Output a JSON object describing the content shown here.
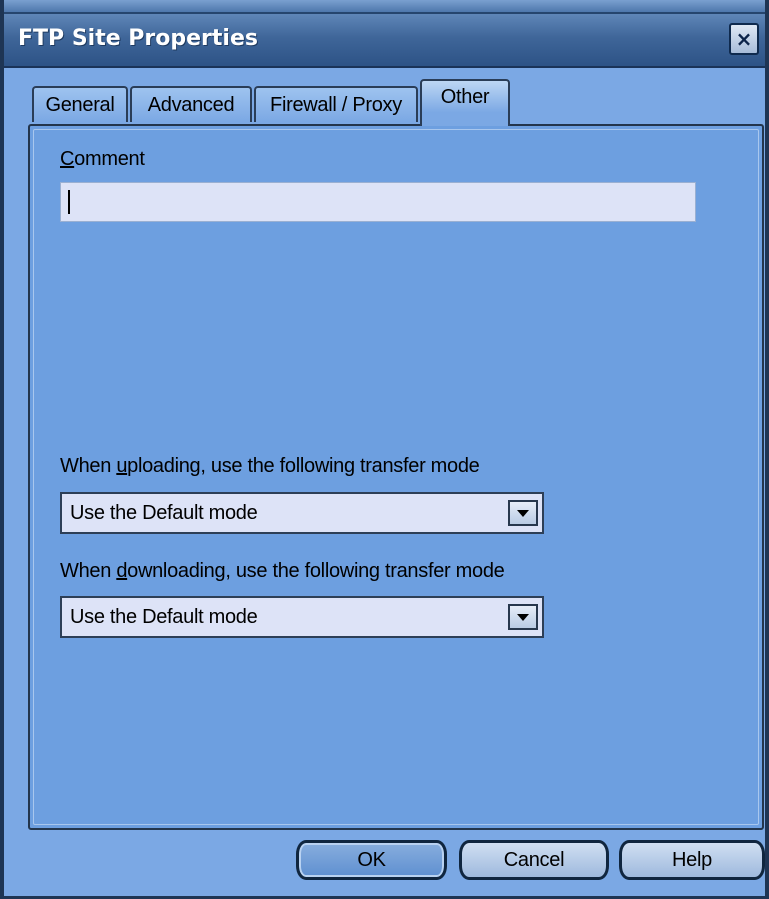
{
  "window": {
    "title": "FTP Site Properties",
    "close_glyph": "×"
  },
  "tabs": [
    {
      "label": "General",
      "active": false
    },
    {
      "label": "Advanced",
      "active": false
    },
    {
      "label": "Firewall / Proxy",
      "active": false
    },
    {
      "label": "Other",
      "active": true
    }
  ],
  "comment": {
    "label_mnemonic": "C",
    "label_rest": "omment",
    "value": ""
  },
  "upload": {
    "label_before": "When ",
    "label_mnemonic": "u",
    "label_after": "ploading, use the following transfer mode",
    "selected": "Use the Default mode"
  },
  "download": {
    "label_before": "When ",
    "label_mnemonic": "d",
    "label_after": "ownloading, use the following transfer mode",
    "selected": "Use the Default mode"
  },
  "buttons": {
    "ok": "OK",
    "cancel": "Cancel",
    "help": "Help"
  },
  "icons": {
    "close": "close-icon",
    "dropdown": "chevron-down-icon"
  },
  "colors": {
    "titlebar": "#3f6699",
    "dialog_bg": "#7ba8e4",
    "panel_bg": "#6d9fe0",
    "input_bg": "#dde3f7",
    "border": "#1e3554"
  }
}
